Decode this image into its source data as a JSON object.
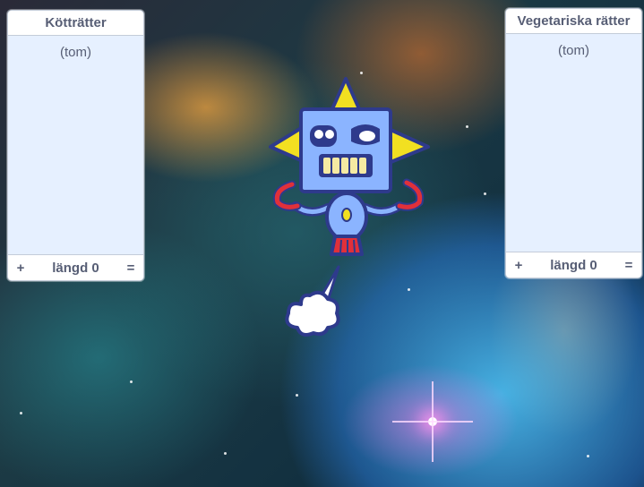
{
  "stage": {
    "background": "nebula-space",
    "sprites": [
      {
        "name": "robot-sprite",
        "icon": "robot-icon"
      },
      {
        "name": "exhaust-puff-sprite",
        "icon": "smoke-cloud-icon"
      }
    ]
  },
  "lists": {
    "meat": {
      "title": "Kötträtter",
      "empty_text": "(tom)",
      "add_label": "+",
      "length_label": "längd 0",
      "resize_label": "="
    },
    "veg": {
      "title": "Vegetariska rätter",
      "empty_text": "(tom)",
      "add_label": "+",
      "length_label": "längd 0",
      "resize_label": "="
    }
  },
  "colors": {
    "monitor_bg": "#e6f0ff",
    "monitor_text": "#575e75",
    "robot_body": "#8bb4ff",
    "robot_outline": "#2e3a8c",
    "robot_spikes": "#f2e021",
    "robot_arms": "#e0303a"
  }
}
